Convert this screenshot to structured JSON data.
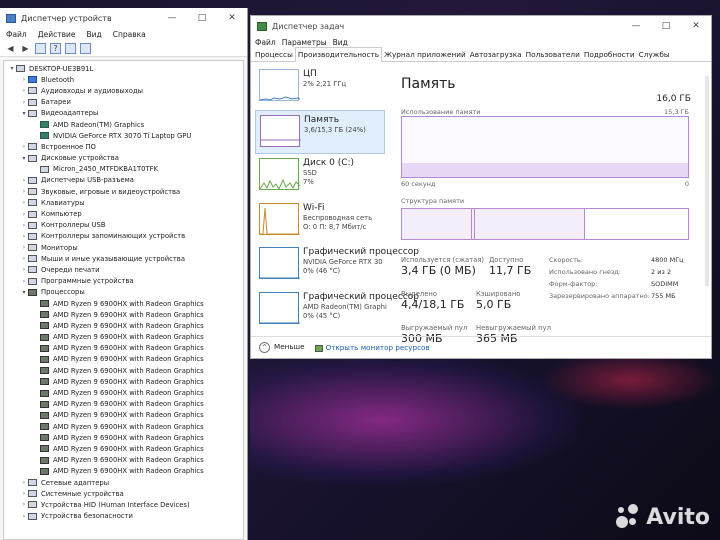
{
  "device_manager": {
    "title": "Диспетчер устройств",
    "menu": [
      "Файл",
      "Действие",
      "Вид",
      "Справка"
    ],
    "tree": [
      {
        "level": 0,
        "arrow": "v",
        "icon": "computer-icon",
        "label": "DESKTOP-UE3B91L"
      },
      {
        "level": 1,
        "arrow": ">",
        "icon": "bluetooth-icon",
        "label": "Bluetooth"
      },
      {
        "level": 1,
        "arrow": ">",
        "icon": "audio-icon",
        "label": "Аудиовходы и аудиовыходы"
      },
      {
        "level": 1,
        "arrow": ">",
        "icon": "battery-icon",
        "label": "Батареи"
      },
      {
        "level": 1,
        "arrow": "v",
        "icon": "display-adapter-icon",
        "label": "Видеоадаптеры"
      },
      {
        "level": 2,
        "arrow": "",
        "icon": "gpu-icon",
        "label": "AMD Radeon(TM) Graphics"
      },
      {
        "level": 2,
        "arrow": "",
        "icon": "gpu-icon",
        "label": "NVIDIA GeForce RTX 3070 Ti Laptop GPU"
      },
      {
        "level": 1,
        "arrow": ">",
        "icon": "firmware-icon",
        "label": "Встроенное ПО"
      },
      {
        "level": 1,
        "arrow": "v",
        "icon": "disk-icon",
        "label": "Дисковые устройства"
      },
      {
        "level": 2,
        "arrow": "",
        "icon": "disk-icon",
        "label": "Micron_2450_MTFDKBA1T0TFK"
      },
      {
        "level": 1,
        "arrow": ">",
        "icon": "usb-icon",
        "label": "Диспетчеры USB-разъема"
      },
      {
        "level": 1,
        "arrow": ">",
        "icon": "sound-icon",
        "label": "Звуковые, игровые и видеоустройства"
      },
      {
        "level": 1,
        "arrow": ">",
        "icon": "keyboard-icon",
        "label": "Клавиатуры"
      },
      {
        "level": 1,
        "arrow": ">",
        "icon": "computer-icon",
        "label": "Компьютер"
      },
      {
        "level": 1,
        "arrow": ">",
        "icon": "usb-icon",
        "label": "Контроллеры USB"
      },
      {
        "level": 1,
        "arrow": ">",
        "icon": "storage-icon",
        "label": "Контроллеры запоминающих устройств"
      },
      {
        "level": 1,
        "arrow": ">",
        "icon": "monitor-icon",
        "label": "Мониторы"
      },
      {
        "level": 1,
        "arrow": ">",
        "icon": "mouse-icon",
        "label": "Мыши и иные указывающие устройства"
      },
      {
        "level": 1,
        "arrow": ">",
        "icon": "printer-icon",
        "label": "Очереди печати"
      },
      {
        "level": 1,
        "arrow": ">",
        "icon": "software-icon",
        "label": "Программные устройства"
      },
      {
        "level": 1,
        "arrow": "v",
        "icon": "cpu-icon",
        "label": "Процессоры"
      },
      {
        "level": 2,
        "arrow": "",
        "icon": "cpu-icon",
        "label": "AMD Ryzen 9 6900HX with Radeon Graphics"
      },
      {
        "level": 2,
        "arrow": "",
        "icon": "cpu-icon",
        "label": "AMD Ryzen 9 6900HX with Radeon Graphics"
      },
      {
        "level": 2,
        "arrow": "",
        "icon": "cpu-icon",
        "label": "AMD Ryzen 9 6900HX with Radeon Graphics"
      },
      {
        "level": 2,
        "arrow": "",
        "icon": "cpu-icon",
        "label": "AMD Ryzen 9 6900HX with Radeon Graphics"
      },
      {
        "level": 2,
        "arrow": "",
        "icon": "cpu-icon",
        "label": "AMD Ryzen 9 6900HX with Radeon Graphics"
      },
      {
        "level": 2,
        "arrow": "",
        "icon": "cpu-icon",
        "label": "AMD Ryzen 9 6900HX with Radeon Graphics"
      },
      {
        "level": 2,
        "arrow": "",
        "icon": "cpu-icon",
        "label": "AMD Ryzen 9 6900HX with Radeon Graphics"
      },
      {
        "level": 2,
        "arrow": "",
        "icon": "cpu-icon",
        "label": "AMD Ryzen 9 6900HX with Radeon Graphics"
      },
      {
        "level": 2,
        "arrow": "",
        "icon": "cpu-icon",
        "label": "AMD Ryzen 9 6900HX with Radeon Graphics"
      },
      {
        "level": 2,
        "arrow": "",
        "icon": "cpu-icon",
        "label": "AMD Ryzen 9 6900HX with Radeon Graphics"
      },
      {
        "level": 2,
        "arrow": "",
        "icon": "cpu-icon",
        "label": "AMD Ryzen 9 6900HX with Radeon Graphics"
      },
      {
        "level": 2,
        "arrow": "",
        "icon": "cpu-icon",
        "label": "AMD Ryzen 9 6900HX with Radeon Graphics"
      },
      {
        "level": 2,
        "arrow": "",
        "icon": "cpu-icon",
        "label": "AMD Ryzen 9 6900HX with Radeon Graphics"
      },
      {
        "level": 2,
        "arrow": "",
        "icon": "cpu-icon",
        "label": "AMD Ryzen 9 6900HX with Radeon Graphics"
      },
      {
        "level": 2,
        "arrow": "",
        "icon": "cpu-icon",
        "label": "AMD Ryzen 9 6900HX with Radeon Graphics"
      },
      {
        "level": 2,
        "arrow": "",
        "icon": "cpu-icon",
        "label": "AMD Ryzen 9 6900HX with Radeon Graphics"
      },
      {
        "level": 1,
        "arrow": ">",
        "icon": "network-adapter-icon",
        "label": "Сетевые адаптеры"
      },
      {
        "level": 1,
        "arrow": ">",
        "icon": "system-device-icon",
        "label": "Системные устройства"
      },
      {
        "level": 1,
        "arrow": ">",
        "icon": "hid-icon",
        "label": "Устройства HID (Human Interface Devices)"
      },
      {
        "level": 1,
        "arrow": ">",
        "icon": "security-icon",
        "label": "Устройства безопасности"
      }
    ]
  },
  "task_manager": {
    "title": "Диспетчер задач",
    "menu": [
      "Файл",
      "Параметры",
      "Вид"
    ],
    "tabs": [
      "Процессы",
      "Производительность",
      "Журнал приложений",
      "Автозагрузка",
      "Пользователи",
      "Подробности",
      "Службы"
    ],
    "active_tab": 1,
    "perf_items": [
      {
        "name": "ЦП",
        "line1": "2%  2,21 ГГц",
        "line2": "",
        "type": "cpu",
        "selected": false
      },
      {
        "name": "Память",
        "line1": "3,6/15,3 ГБ (24%)",
        "line2": "",
        "type": "mem",
        "selected": true
      },
      {
        "name": "Диск 0 (C:)",
        "line1": "SSD",
        "line2": "7%",
        "type": "disk",
        "selected": false
      },
      {
        "name": "Wi-Fi",
        "line1": "Беспроводная сеть",
        "line2": "О: 0 П: 8,7 Мбит/с",
        "type": "wifi",
        "selected": false
      },
      {
        "name": "Графический процессор",
        "line1": "NVIDIA GeForce RTX 30",
        "line2": "0%  (46 °C)",
        "type": "gpu",
        "selected": false
      },
      {
        "name": "Графический процессор",
        "line1": "AMD Radeon(TM) Graphi",
        "line2": "0%  (45 °C)",
        "type": "gpu",
        "selected": false
      }
    ],
    "memory": {
      "title": "Память",
      "total": "16,0 ГБ",
      "usage_label": "Использование памяти",
      "usage_max": "15,3 ГБ",
      "time_left": "60 секунд",
      "time_right": "0",
      "structure_label": "Структура памяти",
      "usage_fraction": 0.24,
      "stats": [
        {
          "key": "Используется (сжатая)",
          "value": "3,4 ГБ (0 МБ)"
        },
        {
          "key": "Доступно",
          "value": "11,7 ГБ"
        },
        {
          "key": "Выделено",
          "value": "4,4/18,1 ГБ"
        },
        {
          "key": "Кэшировано",
          "value": "5,0 ГБ"
        },
        {
          "key": "Выгружаемый пул",
          "value": "300 МБ"
        },
        {
          "key": "Невыгружаемый пул",
          "value": "365 МБ"
        }
      ],
      "right_stats": [
        {
          "key": "Скорость:",
          "value": "4800 МГц"
        },
        {
          "key": "Использовано гнезд:",
          "value": "2 из 2"
        },
        {
          "key": "Форм-фактор:",
          "value": "SODIMM"
        },
        {
          "key": "Зарезервировано аппаратно:",
          "value": "755 МБ"
        }
      ]
    },
    "footer": {
      "less": "Меньше",
      "monitor": "Открыть монитор ресурсов"
    }
  },
  "watermark": "Avito"
}
